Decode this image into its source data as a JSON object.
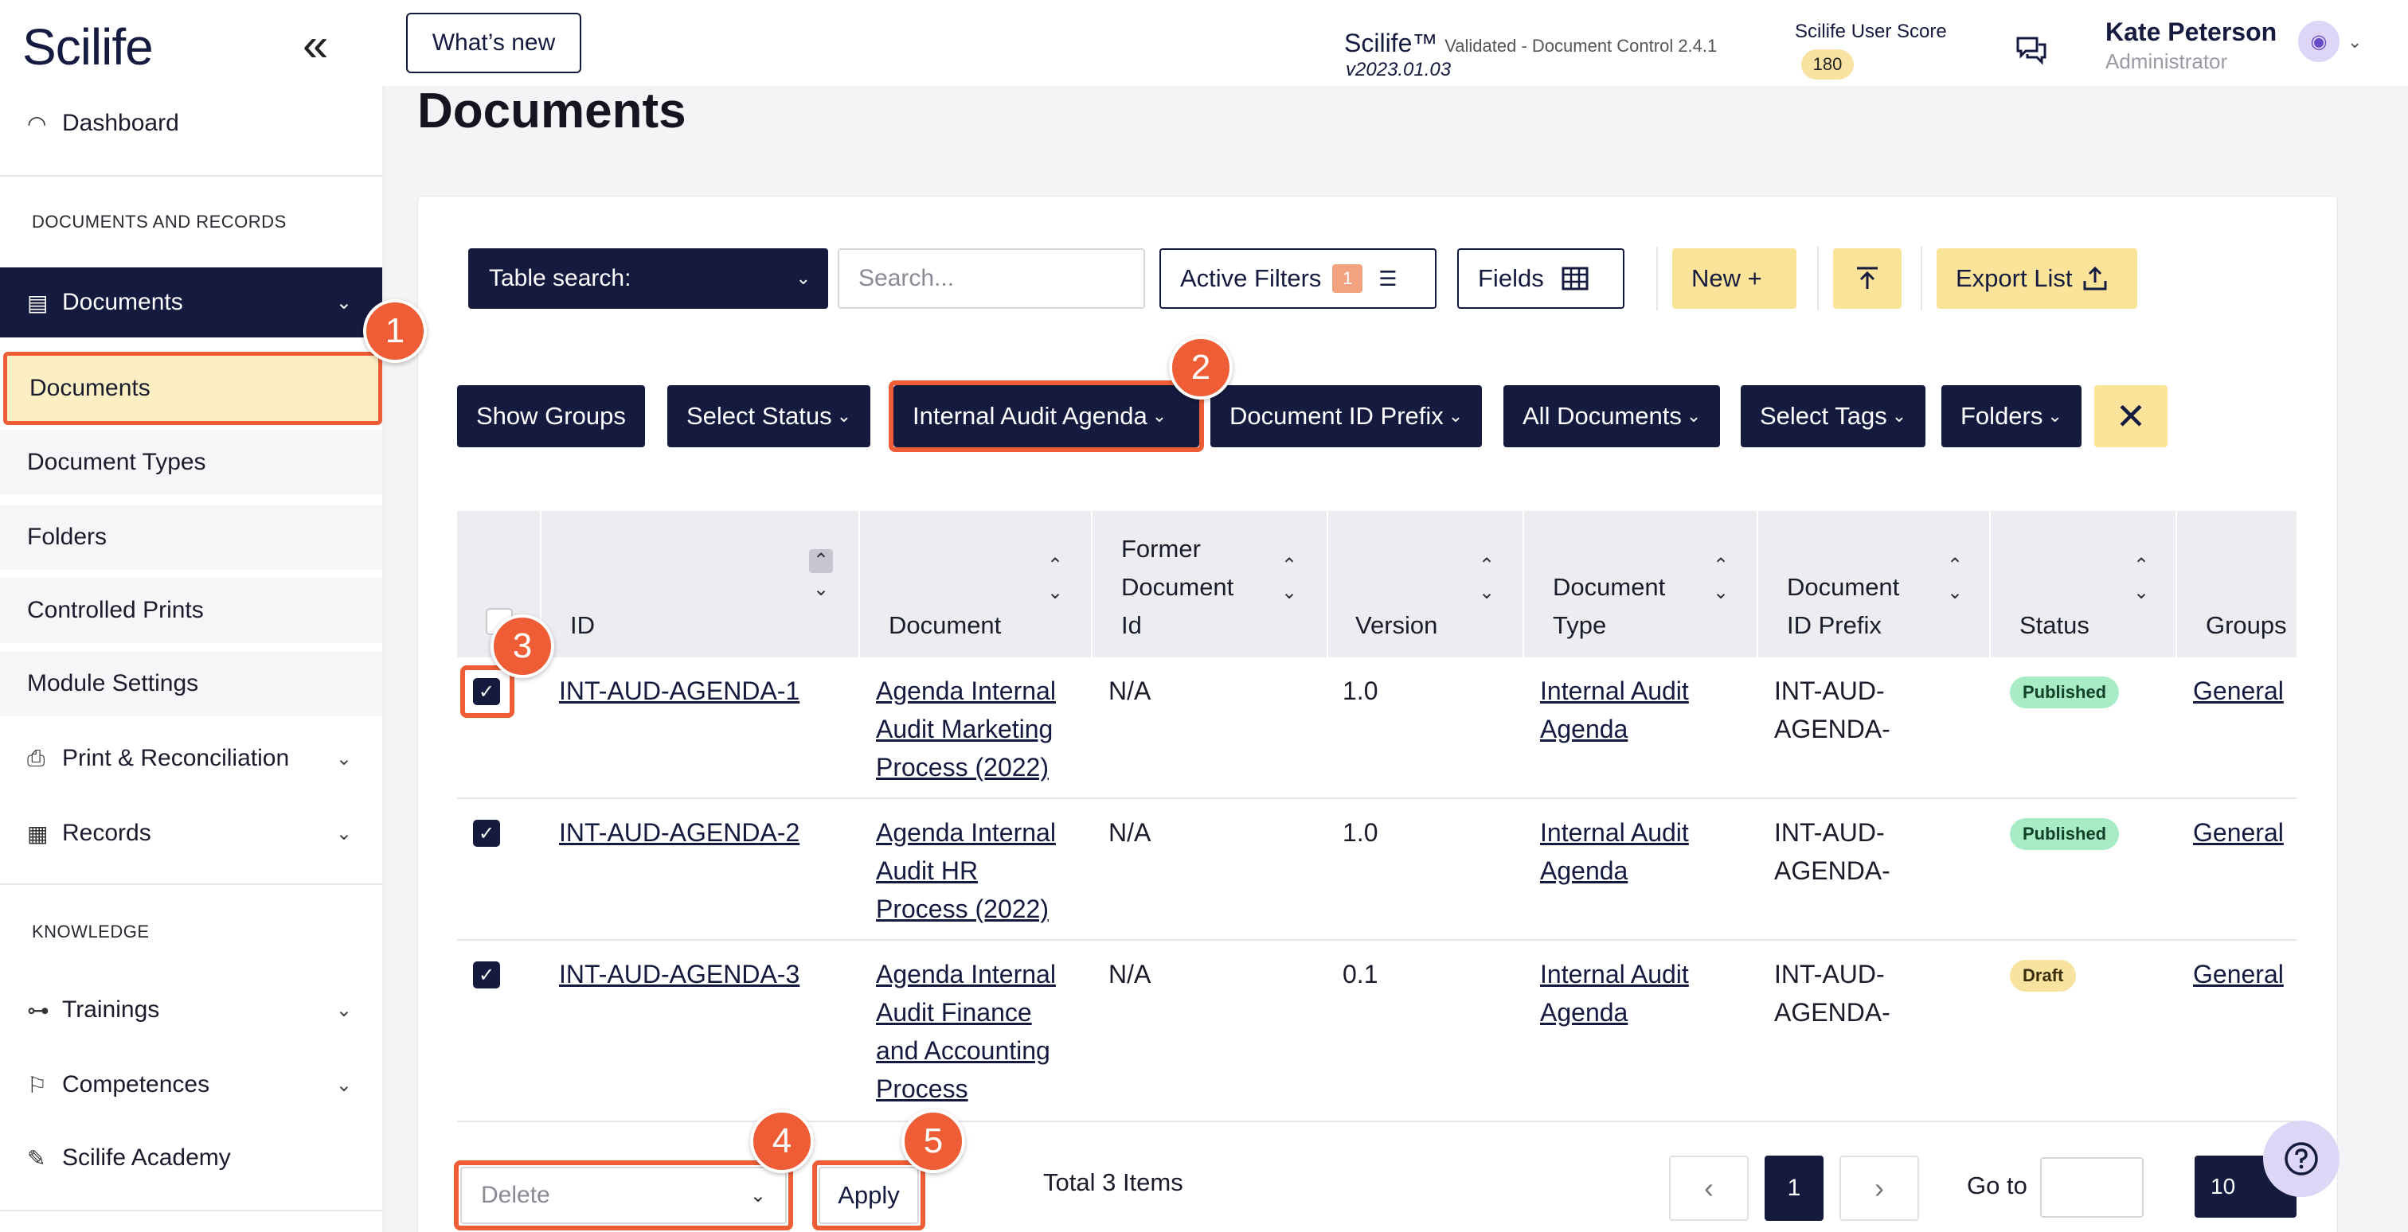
{
  "app": {
    "logo": "Scilife",
    "collapse_glyph": "«",
    "whats_new": "What’s new",
    "product_name": "Scilife™",
    "product_desc": "Validated - Document Control 2.4.1",
    "product_version": "v2023.01.03",
    "score_label": "Scilife User Score",
    "score_value": "180",
    "user_name": "Kate Peterson",
    "user_role": "Administrator"
  },
  "sidebar": {
    "dashboard": "Dashboard",
    "section_docs": "DOCUMENTS AND RECORDS",
    "documents_group": "Documents",
    "documents_sub": [
      "Documents",
      "Document Types",
      "Folders",
      "Controlled Prints",
      "Module Settings"
    ],
    "print_reconciliation": "Print & Reconciliation",
    "records": "Records",
    "section_knowledge": "KNOWLEDGE",
    "trainings": "Trainings",
    "competences": "Competences",
    "academy": "Scilife Academy"
  },
  "page": {
    "title": "Documents"
  },
  "toolbar": {
    "table_search": "Table search:",
    "search_placeholder": "Search...",
    "active_filters": "Active Filters",
    "active_filters_count": "1",
    "fields": "Fields",
    "new": "New +",
    "export_list": "Export List"
  },
  "chips": [
    "Show Groups",
    "Select Status",
    "Internal Audit Agenda",
    "Document ID Prefix",
    "All Documents",
    "Select Tags",
    "Folders"
  ],
  "table": {
    "headers": {
      "id": "ID",
      "document": "Document",
      "former_l1": "Former",
      "former_l2": "Document",
      "former_l3": "Id",
      "version": "Version",
      "doctype_l1": "Document",
      "doctype_l2": "Type",
      "prefix_l1": "Document",
      "prefix_l2": "ID Prefix",
      "status": "Status",
      "groups": "Groups"
    },
    "rows": [
      {
        "id": "INT-AUD-AGENDA-1",
        "doc_l1": "Agenda Internal",
        "doc_l2": "Audit Marketing",
        "doc_l3": "Process (2022)",
        "doc_l4": "",
        "former": "N/A",
        "version": "1.0",
        "type_l1": "Internal Audit",
        "type_l2": "Agenda",
        "prefix_l1": "INT-AUD-",
        "prefix_l2": "AGENDA-",
        "status": "Published",
        "groups": "General"
      },
      {
        "id": "INT-AUD-AGENDA-2",
        "doc_l1": "Agenda Internal",
        "doc_l2": "Audit HR",
        "doc_l3": "Process (2022)",
        "doc_l4": "",
        "former": "N/A",
        "version": "1.0",
        "type_l1": "Internal Audit",
        "type_l2": "Agenda",
        "prefix_l1": "INT-AUD-",
        "prefix_l2": "AGENDA-",
        "status": "Published",
        "groups": "General"
      },
      {
        "id": "INT-AUD-AGENDA-3",
        "doc_l1": "Agenda Internal",
        "doc_l2": "Audit Finance",
        "doc_l3": "and Accounting",
        "doc_l4": "Process",
        "former": "N/A",
        "version": "0.1",
        "type_l1": "Internal Audit",
        "type_l2": "Agenda",
        "prefix_l1": "INT-AUD-",
        "prefix_l2": "AGENDA-",
        "status": "Draft",
        "groups": "General"
      }
    ]
  },
  "footer": {
    "bulk_action": "Delete",
    "apply": "Apply",
    "total": "Total 3 Items",
    "current_page": "1",
    "goto_label": "Go to",
    "page_size": "10"
  },
  "callouts": [
    "1",
    "2",
    "3",
    "4",
    "5"
  ],
  "colors": {
    "navy": "#151a3f",
    "accent_orange": "#ee5d36",
    "yellow": "#fbe49a",
    "selected_bg": "#fdefc4",
    "published": "#a8ecc6",
    "draft": "#f8e3a1"
  }
}
